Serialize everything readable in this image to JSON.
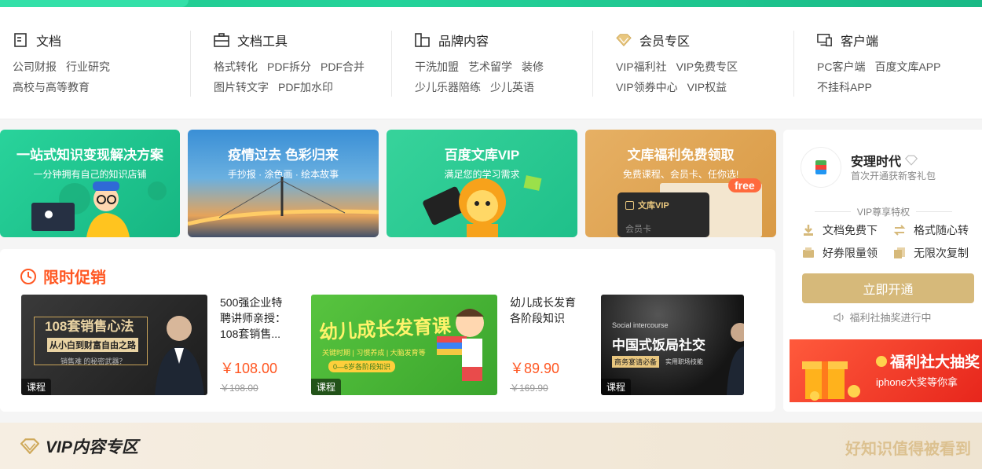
{
  "nav": [
    {
      "title": "文档",
      "icon": "document-icon",
      "links": [
        [
          "公司财报",
          "行业研究"
        ],
        [
          "高校与高等教育"
        ]
      ]
    },
    {
      "title": "文档工具",
      "icon": "toolbox-icon",
      "links": [
        [
          "格式转化",
          "PDF拆分",
          "PDF合并"
        ],
        [
          "图片转文字",
          "PDF加水印"
        ]
      ]
    },
    {
      "title": "品牌内容",
      "icon": "brand-book-icon",
      "links": [
        [
          "干洗加盟",
          "艺术留学",
          "装修"
        ],
        [
          "少儿乐器陪练",
          "少儿英语"
        ]
      ]
    },
    {
      "title": "会员专区",
      "icon": "diamond-icon",
      "links": [
        [
          "VIP福利社",
          "VIP免费专区"
        ],
        [
          "VIP领券中心",
          "VIP权益"
        ]
      ]
    },
    {
      "title": "客户端",
      "icon": "client-devices-icon",
      "links": [
        [
          "PC客户端",
          "百度文库APP"
        ],
        [
          "不挂科APP"
        ]
      ]
    }
  ],
  "banners": [
    {
      "title": "一站式知识变现解决方案",
      "subtitle": "一分钟拥有自己的知识店铺"
    },
    {
      "title": "疫情过去 色彩归来",
      "subtitle": "手抄报 · 涂色画 · 绘本故事"
    },
    {
      "title": "百度文库VIP",
      "subtitle": "满足您的学习需求"
    },
    {
      "title": "文库福利免费领取",
      "subtitle": "免费课程、会员卡、任你选!",
      "badge": "free",
      "card_label": "文库VIP",
      "card_sub": "会员卡"
    }
  ],
  "promo": {
    "title": "限时促销",
    "items": [
      {
        "img_text": "108套销售心法",
        "img_sub": "从小白到财富自由之路",
        "img_note": "销售难 的秘密武器？",
        "tag": "课程",
        "name": "500强企业特聘讲师亲授：108套销售...",
        "price": "￥108.00",
        "old": "￥108.00"
      },
      {
        "img_text": "幼儿成长发育课",
        "img_sub": "关键时期 | 习惯养成 | 大脑发育等",
        "img_note": "0—6岁各阶段知识",
        "tag": "课程",
        "name": "幼儿成长发育各阶段知识",
        "price": "￥89.90",
        "old": "￥169.90"
      },
      {
        "img_text": "中国式饭局社交",
        "img_sub": "Social intercourse",
        "img_note": "商务宴请必备",
        "img_note2": "实用职场技能",
        "tag": "课程"
      }
    ]
  },
  "side": {
    "user": "安理时代",
    "user_sub": "首次开通获新客礼包",
    "vip_title": "VIP尊享特权",
    "perks": [
      "文档免费下",
      "格式随心转",
      "好券限量领",
      "无限次复制"
    ],
    "open_btn": "立即开通",
    "notice": "福利社抽奖进行中",
    "lottery_title": "福利社大抽奖",
    "lottery_sub": "iphone大奖等你拿"
  },
  "vip_section": {
    "title": "VIP内容专区",
    "slogan": "好知识值得被看到"
  },
  "colors": {
    "accent": "#ff5722",
    "gold": "#d6b97a",
    "green": "#1fc98f"
  }
}
